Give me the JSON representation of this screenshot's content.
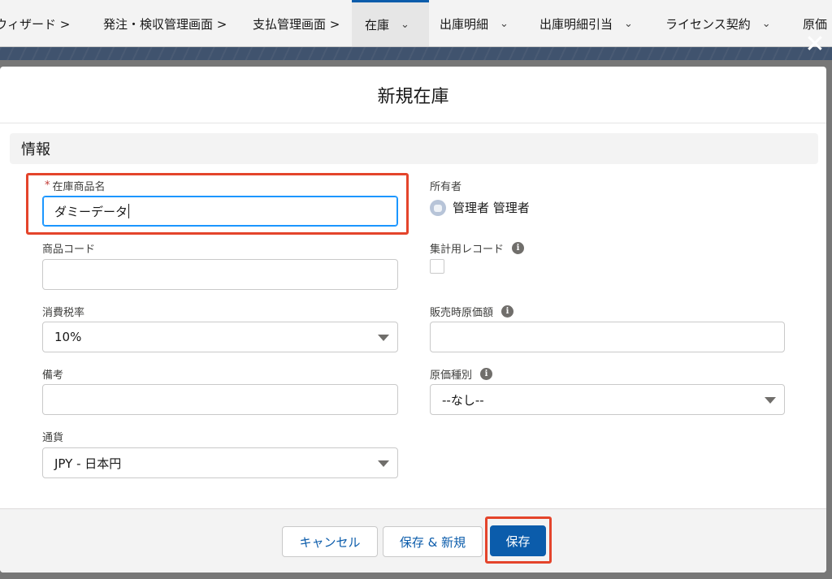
{
  "nav": {
    "tabs": [
      {
        "label": "セットアップウィザード >"
      },
      {
        "label": "発注・検収管理画面 >"
      },
      {
        "label": "支払管理画面 >"
      },
      {
        "label": "在庫"
      },
      {
        "label": "出庫明細"
      },
      {
        "label": "出庫明細引当"
      },
      {
        "label": "ライセンス契約"
      },
      {
        "label": "原価"
      }
    ]
  },
  "colors": {
    "brand": "#0b5cab",
    "highlight": "#e4442b",
    "focus": "#1b96ff"
  },
  "modal": {
    "title": "新規在庫",
    "close_icon": "close-icon",
    "section_title": "情報",
    "fields": {
      "name": {
        "label": "在庫商品名",
        "required_mark": "*",
        "value": "ダミーデータ"
      },
      "owner": {
        "label": "所有者",
        "value": "管理者 管理者"
      },
      "product_code": {
        "label": "商品コード",
        "value": ""
      },
      "summary_record": {
        "label": "集計用レコード",
        "checked": false
      },
      "tax_rate": {
        "label": "消費税率",
        "value": "10%"
      },
      "sales_cost": {
        "label": "販売時原価額",
        "value": ""
      },
      "remarks": {
        "label": "備考",
        "value": ""
      },
      "cost_type": {
        "label": "原価種別",
        "value": "--なし--"
      },
      "currency": {
        "label": "通貨",
        "value": "JPY - 日本円"
      }
    },
    "info_icon_glyph": "i",
    "buttons": {
      "cancel": "キャンセル",
      "save_new": "保存 & 新規",
      "save": "保存"
    }
  }
}
